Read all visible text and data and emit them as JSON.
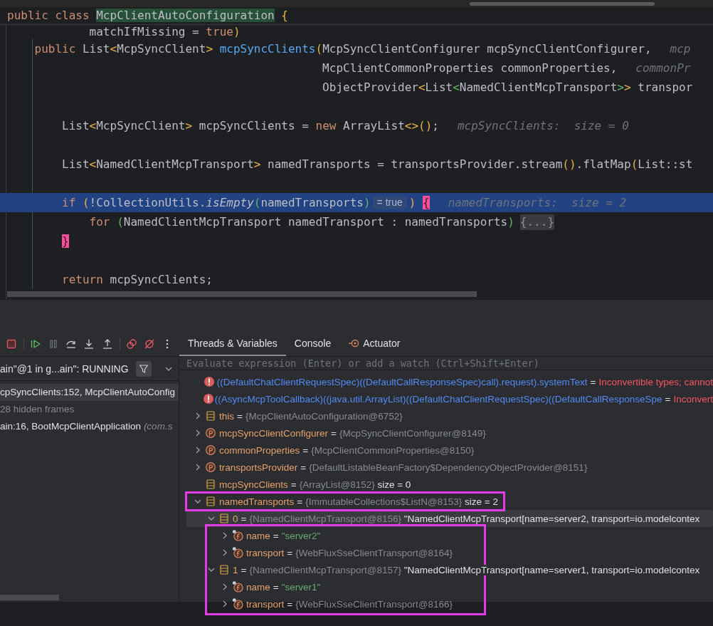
{
  "editor": {
    "sticky_line": {
      "parts": [
        {
          "kind": "code",
          "tokens": [
            {
              "t": "public class ",
              "kind": "kw"
            },
            {
              "t": "McpClientAutoConfiguration",
              "kind": "mark"
            },
            {
              "t": " {",
              "kind": "br1"
            }
          ]
        }
      ]
    },
    "lines": [
      {
        "highlighted": false,
        "parts": [
          {
            "kind": "code",
            "tokens": [
              {
                "t": "            matchIfMissing = ",
                "kind": "plain"
              },
              {
                "t": "true",
                "kind": "kw"
              },
              {
                "t": ")",
                "kind": "br1"
              }
            ]
          }
        ]
      },
      {
        "highlighted": false,
        "parts": [
          {
            "kind": "code",
            "tokens": [
              {
                "t": "    public ",
                "kind": "kw"
              },
              {
                "t": "List",
                "kind": "plain"
              },
              {
                "t": "<",
                "kind": "br1"
              },
              {
                "t": "McpSyncClient",
                "kind": "plain"
              },
              {
                "t": "> ",
                "kind": "br1"
              },
              {
                "t": "mcpSyncClients",
                "kind": "fn"
              },
              {
                "t": "(",
                "kind": "br1"
              },
              {
                "t": "McpSyncClientConfigurer mcpSyncClientConfigurer,",
                "kind": "plain"
              }
            ]
          },
          {
            "kind": "hint",
            "text": "mcp"
          }
        ]
      },
      {
        "highlighted": false,
        "parts": [
          {
            "kind": "code",
            "tokens": [
              {
                "t": "                                              McpClientCommonProperties commonProperties,",
                "kind": "plain"
              }
            ]
          },
          {
            "kind": "hint",
            "text": "commonPr"
          }
        ]
      },
      {
        "highlighted": false,
        "parts": [
          {
            "kind": "code",
            "tokens": [
              {
                "t": "                                              ObjectProvider",
                "kind": "plain"
              },
              {
                "t": "<",
                "kind": "br1"
              },
              {
                "t": "List",
                "kind": "plain"
              },
              {
                "t": "<",
                "kind": "br2"
              },
              {
                "t": "NamedClientMcpTransport",
                "kind": "plain"
              },
              {
                "t": ">",
                "kind": "br2"
              },
              {
                "t": ">",
                "kind": "br1"
              },
              {
                "t": " transpor",
                "kind": "plain"
              }
            ]
          }
        ]
      },
      {
        "highlighted": false
      },
      {
        "highlighted": false,
        "parts": [
          {
            "kind": "code",
            "tokens": [
              {
                "t": "        List",
                "kind": "plain"
              },
              {
                "t": "<",
                "kind": "br1"
              },
              {
                "t": "McpSyncClient",
                "kind": "plain"
              },
              {
                "t": ">",
                "kind": "br1"
              },
              {
                "t": " mcpSyncClients = ",
                "kind": "plain"
              },
              {
                "t": "new",
                "kind": "kw"
              },
              {
                "t": " ArrayList",
                "kind": "plain"
              },
              {
                "t": "<>()",
                "kind": "br1"
              },
              {
                "t": ";",
                "kind": "plain"
              }
            ]
          },
          {
            "kind": "hint",
            "text": "mcpSyncClients:  size = 0"
          }
        ]
      },
      {
        "highlighted": false
      },
      {
        "highlighted": false,
        "parts": [
          {
            "kind": "code",
            "tokens": [
              {
                "t": "        List",
                "kind": "plain"
              },
              {
                "t": "<",
                "kind": "br1"
              },
              {
                "t": "NamedClientMcpTransport",
                "kind": "plain"
              },
              {
                "t": ">",
                "kind": "br1"
              },
              {
                "t": " namedTransports = transportsProvider.stream",
                "kind": "plain"
              },
              {
                "t": "()",
                "kind": "br1"
              },
              {
                "t": ".flatMap",
                "kind": "plain"
              },
              {
                "t": "(",
                "kind": "br1"
              },
              {
                "t": "List::st",
                "kind": "plain"
              }
            ]
          }
        ]
      },
      {
        "highlighted": false
      },
      {
        "highlighted": true,
        "parts": [
          {
            "kind": "code",
            "tokens": [
              {
                "t": "        if ",
                "kind": "kw"
              },
              {
                "t": "(",
                "kind": "br1"
              },
              {
                "t": "!CollectionUtils.",
                "kind": "plain"
              },
              {
                "t": "isEmpty",
                "kind": "it"
              },
              {
                "t": "(",
                "kind": "br2"
              },
              {
                "t": "namedTransports",
                "kind": "plain"
              },
              {
                "t": ")",
                "kind": "br2"
              }
            ]
          },
          {
            "kind": "inlay",
            "text": "= true"
          },
          {
            "kind": "code",
            "tokens": [
              {
                "t": ") ",
                "kind": "br1"
              },
              {
                "t": "{",
                "kind": "brace"
              }
            ]
          },
          {
            "kind": "hint",
            "text": "namedTransports:  size = 2"
          }
        ]
      },
      {
        "highlighted": false,
        "parts": [
          {
            "kind": "code",
            "tokens": [
              {
                "t": "            for ",
                "kind": "kw"
              },
              {
                "t": "(",
                "kind": "br2"
              },
              {
                "t": "NamedClientMcpTransport namedTransport : namedTransports",
                "kind": "plain"
              },
              {
                "t": ")",
                "kind": "br2"
              }
            ]
          },
          {
            "kind": "fold",
            "text": "{...}"
          }
        ]
      },
      {
        "highlighted": false,
        "parts": [
          {
            "kind": "code",
            "tokens": [
              {
                "t": "        }",
                "kind": "brace"
              }
            ]
          }
        ]
      },
      {
        "highlighted": false
      },
      {
        "highlighted": false,
        "parts": [
          {
            "kind": "code",
            "tokens": [
              {
                "t": "        return",
                "kind": "kw"
              },
              {
                "t": " mcpSyncClients;",
                "kind": "plain"
              }
            ]
          }
        ]
      }
    ]
  },
  "toolbar": [
    {
      "kind": "stop"
    },
    {
      "kind": "separator"
    },
    {
      "kind": "resume"
    },
    {
      "kind": "pause"
    },
    {
      "kind": "step-over"
    },
    {
      "kind": "step-into"
    },
    {
      "kind": "step-out"
    },
    {
      "kind": "separator"
    },
    {
      "kind": "breakpoints"
    },
    {
      "kind": "mute"
    },
    {
      "kind": "more"
    }
  ],
  "tabs": [
    {
      "label": "Threads & Variables",
      "kind": "plain",
      "selected": true
    },
    {
      "label": "Console",
      "kind": "plain",
      "selected": false
    },
    {
      "label": "Actuator",
      "kind": "target",
      "selected": false
    }
  ],
  "threads": {
    "selector": "ain\"@1 in g...ain\": RUNNING"
  },
  "frames": [
    {
      "kind": "frame",
      "text": "cpSyncClients:152, McpClientAutoConfig",
      "selected": true
    },
    {
      "kind": "hidden",
      "text": "28 hidden frames",
      "selected": false
    },
    {
      "kind": "frame",
      "text": "ain:16, BootMcpClientApplication",
      "location": "(com.s",
      "selected": false
    }
  ],
  "variables": {
    "placeholder": "Evaluate expression (Enter) or add a watch (Ctrl+Shift+Enter)",
    "rows": [
      {
        "kind": "error",
        "expandable": false,
        "name": "((DefaultChatClientRequestSpec)((DefaultCallResponseSpec)call).request).systemText",
        "assign": "=",
        "value": "Inconvertible types; cannot",
        "boxed": false,
        "selected": false
      },
      {
        "kind": "error",
        "expandable": false,
        "name": "((AsyncMcpToolCallback)((java.util.ArrayList)((DefaultChatClientRequestSpec)((DefaultCallResponseSpe",
        "assign": "=",
        "value": "Inconvert",
        "boxed": false,
        "selected": false
      },
      {
        "kind": "list",
        "expandable": true,
        "expanded": false,
        "name": "this",
        "assign": "=",
        "value": "{McpClientAutoConfiguration@6752}",
        "boxed": false,
        "selected": false
      },
      {
        "kind": "param",
        "expandable": true,
        "expanded": false,
        "name": "mcpSyncClientConfigurer",
        "assign": "=",
        "value": "{McpSyncClientConfigurer@8149}",
        "boxed": false,
        "selected": false
      },
      {
        "kind": "param",
        "expandable": true,
        "expanded": false,
        "name": "commonProperties",
        "assign": "=",
        "value": "{McpClientCommonProperties@8150}",
        "boxed": false,
        "selected": false
      },
      {
        "kind": "param",
        "expandable": true,
        "expanded": false,
        "name": "transportsProvider",
        "assign": "=",
        "value": "{DefaultListableBeanFactory$DependencyObjectProvider@8151}",
        "boxed": false,
        "selected": false
      },
      {
        "kind": "list",
        "expandable": false,
        "name": "mcpSyncClients",
        "assign": "=",
        "value": "{ArrayList@8152}",
        "extra": "size = 0",
        "boxed": false,
        "selected": false
      },
      {
        "kind": "list",
        "expandable": true,
        "expanded": true,
        "name": "namedTransports",
        "assign": "=",
        "value": "{ImmutableCollections$ListN@8153}",
        "extra": "size = 2",
        "boxed": true,
        "selected": false,
        "children": [
          {
            "kind": "list",
            "expandable": true,
            "expanded": true,
            "name": "0",
            "assign": "=",
            "value": "{NamedClientMcpTransport@8156}",
            "extra": "\"NamedClientMcpTransport[name=server2, transport=io.modelcontex",
            "boxed": false,
            "selected": true,
            "children": [
              {
                "kind": "string",
                "expandable": true,
                "expanded": false,
                "name": "name",
                "assign": "=",
                "value": "\"server2\"",
                "boxed": true,
                "selected": false
              },
              {
                "kind": "field",
                "expandable": true,
                "expanded": false,
                "name": "transport",
                "assign": "=",
                "value": "{WebFluxSseClientTransport@8164}",
                "boxed": true,
                "selected": false
              }
            ]
          },
          {
            "kind": "list",
            "expandable": true,
            "expanded": true,
            "name": "1",
            "assign": "=",
            "value": "{NamedClientMcpTransport@8157}",
            "extra": "\"NamedClientMcpTransport[name=server1, transport=io.modelcontex",
            "boxed": true,
            "selected": false,
            "children": [
              {
                "kind": "string",
                "expandable": true,
                "expanded": false,
                "name": "name",
                "assign": "=",
                "value": "\"server1\"",
                "boxed": true,
                "selected": false
              },
              {
                "kind": "field",
                "expandable": true,
                "expanded": false,
                "name": "transport",
                "assign": "=",
                "value": "{WebFluxSseClientTransport@8166}",
                "boxed": true,
                "selected": false
              }
            ]
          }
        ]
      }
    ]
  }
}
